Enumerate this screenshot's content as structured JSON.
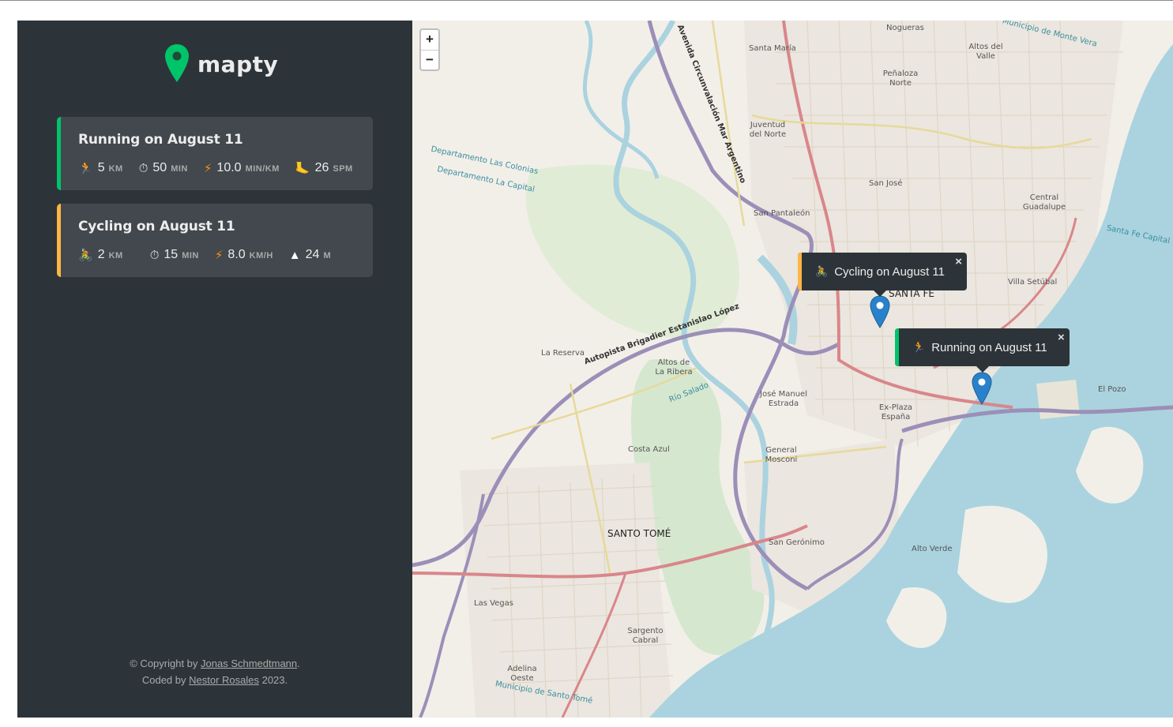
{
  "app": {
    "name": "mapty"
  },
  "workouts": [
    {
      "type": "running",
      "title": "Running on August 11",
      "details": [
        {
          "icon": "running-icon",
          "glyph": "🏃",
          "value": "5",
          "unit": "KM"
        },
        {
          "icon": "stopwatch-icon",
          "glyph": "⏱",
          "value": "50",
          "unit": "MIN"
        },
        {
          "icon": "lightning-icon",
          "glyph": "⚡",
          "value": "10.0",
          "unit": "MIN/KM"
        },
        {
          "icon": "foot-icon",
          "glyph": "🦶",
          "value": "26",
          "unit": "SPM"
        }
      ]
    },
    {
      "type": "cycling",
      "title": "Cycling on August 11",
      "details": [
        {
          "icon": "cycling-icon",
          "glyph": "🚴",
          "value": "2",
          "unit": "KM"
        },
        {
          "icon": "stopwatch-icon",
          "glyph": "⏱",
          "value": "15",
          "unit": "MIN"
        },
        {
          "icon": "lightning-icon",
          "glyph": "⚡",
          "value": "8.0",
          "unit": "KM/H"
        },
        {
          "icon": "mountain-icon",
          "glyph": "▲",
          "value": "24",
          "unit": "M"
        }
      ]
    }
  ],
  "footer": {
    "prefix1": "© Copyright by ",
    "author": "Jonas Schmedtmann",
    "suffix1": ".",
    "prefix2": "Coded by ",
    "coder": "Nestor Rosales",
    "suffix2": " 2023."
  },
  "map": {
    "zoom_in": "+",
    "zoom_out": "−",
    "popups": [
      {
        "text": "Cycling on August 11",
        "glyph": "🚴",
        "close": "×"
      },
      {
        "text": "Running on August 11",
        "glyph": "🏃",
        "close": "×"
      }
    ],
    "labels": {
      "santa_fe": "SANTA FE",
      "santo_tome": "SANTO TOMÉ",
      "nogueras": "Nogueras",
      "santa_maria": "Santa María",
      "altos_del_valle": "Altos del Valle",
      "penaloza_norte": "Peñaloza Norte",
      "juventud_del_norte": "Juventud del Norte",
      "san_jose": "San José",
      "central_guadalupe": "Central Guadalupe",
      "san_pantaleon": "San Pantaleón",
      "villa_setubal": "Villa Setúbal",
      "la_reserva": "La Reserva",
      "altos_de_la_ribera": "Altos de La Ribera",
      "jose_manuel_estrada": "José Manuel Estrada",
      "ex_plaza_espana": "Ex-Plaza España",
      "el_pozo": "El Pozo",
      "costa_azul": "Costa Azul",
      "general_mosconi": "General Mosconi",
      "san_geronimo": "San Gerónimo",
      "alto_verde": "Alto Verde",
      "las_vegas": "Las Vegas",
      "sargento_cabral": "Sargento Cabral",
      "adelina_oeste": "Adelina Oeste",
      "depto_las_colonias": "Departamento Las Colonias",
      "depto_la_capital": "Departamento La Capital",
      "autopista": "Autopista Brigadier Estanislao López",
      "circunvalacion": "Avenida Circunvalación Mar Argentino",
      "rio_salado": "Río Salado",
      "municipio_santo_tome": "Municipio de Santo Tomé",
      "municipio_monte_vera": "Municipio de Monte Vera",
      "santa_fe_capital": "Santa Fe Capital"
    }
  },
  "colors": {
    "sidebar": "#2d3439",
    "card": "#42484d",
    "running": "#00c46a",
    "cycling": "#ffb545",
    "water": "#aad3df",
    "road_primary": "#d9868a",
    "highway": "#9b8fb8"
  }
}
